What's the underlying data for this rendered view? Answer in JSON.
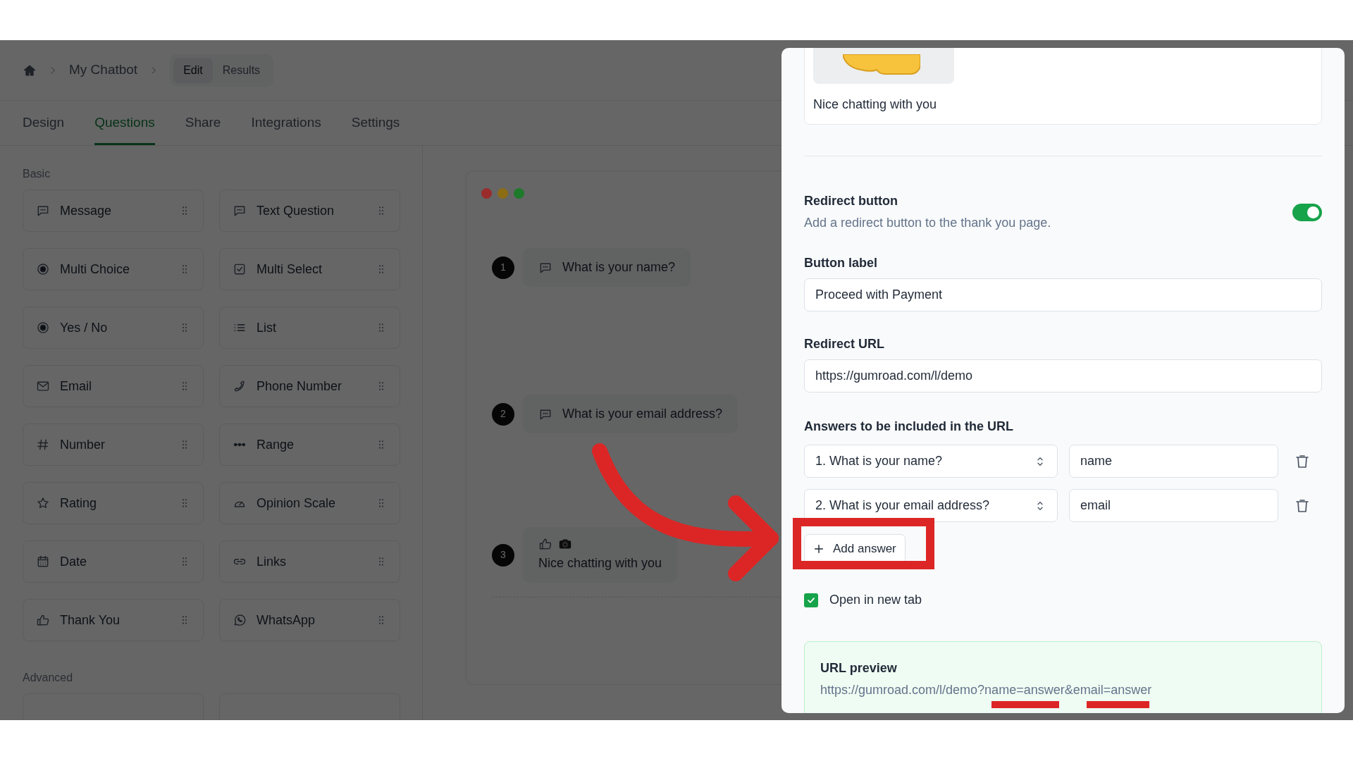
{
  "breadcrumb": {
    "items": [
      {
        "label": "My Chatbot"
      }
    ],
    "segments": [
      {
        "label": "Edit",
        "selected": true
      },
      {
        "label": "Results",
        "selected": false
      }
    ]
  },
  "tabs": [
    {
      "label": "Design",
      "selected": false
    },
    {
      "label": "Questions",
      "selected": true
    },
    {
      "label": "Share",
      "selected": false
    },
    {
      "label": "Integrations",
      "selected": false
    },
    {
      "label": "Settings",
      "selected": false
    }
  ],
  "sidebar": {
    "sections": [
      {
        "title": "Basic",
        "items": [
          {
            "label": "Message",
            "kind": "message"
          },
          {
            "label": "Text Question",
            "kind": "message"
          },
          {
            "label": "Multi Choice",
            "kind": "radio"
          },
          {
            "label": "Multi Select",
            "kind": "checkbox"
          },
          {
            "label": "Yes / No",
            "kind": "radio"
          },
          {
            "label": "List",
            "kind": "list"
          },
          {
            "label": "Email",
            "kind": "mail"
          },
          {
            "label": "Phone Number",
            "kind": "phone"
          },
          {
            "label": "Number",
            "kind": "hash"
          },
          {
            "label": "Range",
            "kind": "range"
          },
          {
            "label": "Rating",
            "kind": "star"
          },
          {
            "label": "Opinion Scale",
            "kind": "gauge"
          },
          {
            "label": "Date",
            "kind": "calendar"
          },
          {
            "label": "Links",
            "kind": "link"
          },
          {
            "label": "Thank You",
            "kind": "thumb"
          },
          {
            "label": "WhatsApp",
            "kind": "whatsapp"
          }
        ]
      },
      {
        "title": "Advanced"
      }
    ]
  },
  "preview": {
    "dots": [
      {
        "color": "#9b2c2c"
      },
      {
        "color": "#8c6d14"
      },
      {
        "color": "#1d7a2b"
      }
    ],
    "messages": [
      {
        "number": "1",
        "kind": "question",
        "text": "What is your name?"
      },
      {
        "number": "2",
        "kind": "question",
        "text": "What is your email address?"
      },
      {
        "number": "3",
        "kind": "thank_you",
        "text": "Nice chatting with you"
      }
    ]
  },
  "panel": {
    "thank_you_card": {
      "caption": "Nice chatting with you"
    },
    "redirect": {
      "title": "Redirect button",
      "description": "Add a redirect button to the thank you page.",
      "on": true
    },
    "button_label": {
      "label": "Button label",
      "value": "Proceed with Payment"
    },
    "redirect_url": {
      "label": "Redirect URL",
      "value": "https://gumroad.com/l/demo"
    },
    "answers": {
      "label": "Answers to be included in the URL",
      "rows": [
        {
          "question": "1. What is your name?",
          "param": "name"
        },
        {
          "question": "2. What is your email address?",
          "param": "email"
        }
      ]
    },
    "add_answer": "Add answer",
    "open_new_tab": {
      "label": "Open in new tab",
      "checked": true
    },
    "url_preview": {
      "title": "URL preview",
      "url": "https://gumroad.com/l/demo?name=answer&email=answer"
    }
  }
}
